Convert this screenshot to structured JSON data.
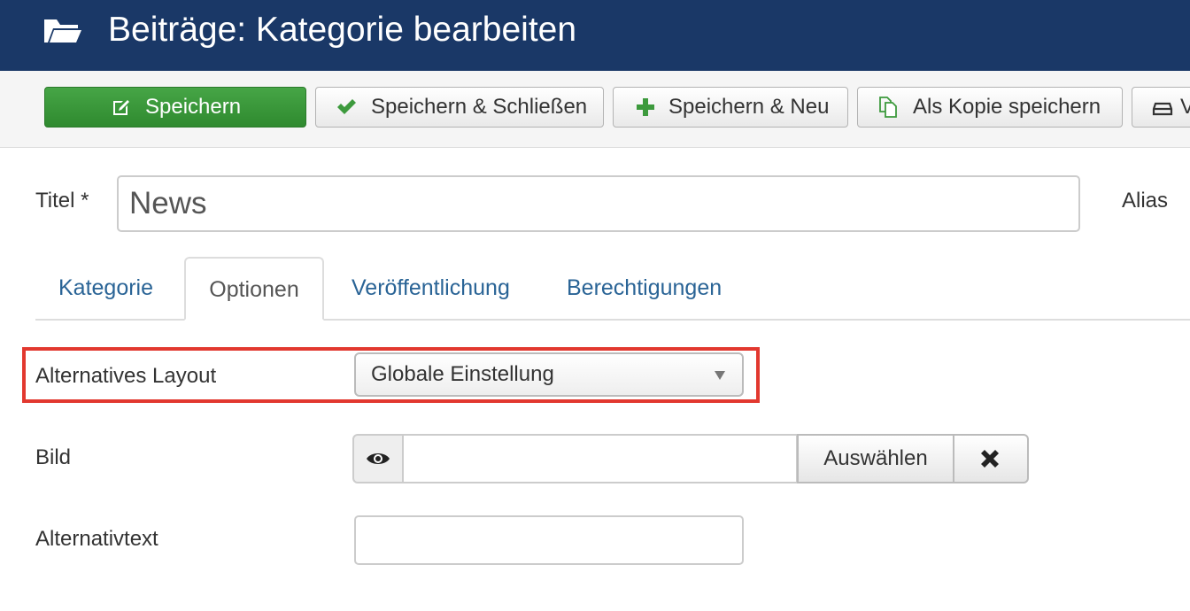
{
  "header": {
    "title": "Beiträge: Kategorie bearbeiten",
    "icon": "folder-open-icon",
    "background": "#1a3867"
  },
  "toolbar": {
    "save_label": "Speichern",
    "save_close_label": "Speichern & Schließen",
    "save_new_label": "Speichern & Neu",
    "save_copy_label": "Als Kopie speichern",
    "more_label": "V",
    "save_color": "#3d9a3d"
  },
  "form": {
    "title_label": "Titel *",
    "title_value": "News",
    "alias_label": "Alias"
  },
  "tabs": [
    {
      "label": "Kategorie",
      "active": false
    },
    {
      "label": "Optionen",
      "active": true
    },
    {
      "label": "Veröffentlichung",
      "active": false
    },
    {
      "label": "Berechtigungen",
      "active": false
    }
  ],
  "options": {
    "layout_label": "Alternatives Layout",
    "layout_value": "Globale Einstellung",
    "image_label": "Bild",
    "image_value": "",
    "select_button": "Auswählen",
    "alt_text_label": "Alternativtext",
    "alt_text_value": "",
    "highlight_color": "#e2382f"
  }
}
